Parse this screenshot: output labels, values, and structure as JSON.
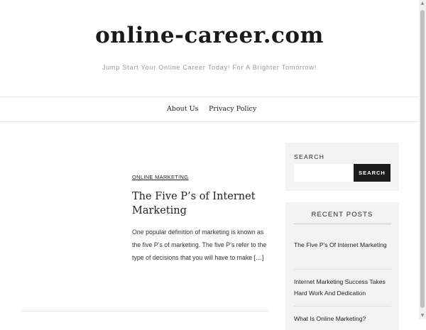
{
  "site": {
    "title": "online-career.com",
    "tagline": "Jump Start Your Online Career Today! For A Brighter Tomorrow!"
  },
  "nav": {
    "items": [
      {
        "label": "About Us"
      },
      {
        "label": "Privacy Policy"
      }
    ]
  },
  "post": {
    "category": "ONLINE MARKETING",
    "title": "The Five P’s of Internet Marketing",
    "excerpt": "One popular definition of marketing is known as the five P’s of marketing. The five P’s refer to the type of decisions that you will have to make […]"
  },
  "sidebar": {
    "search": {
      "label": "SEARCH",
      "placeholder": "",
      "value": "",
      "button_label": "SEARCH"
    },
    "recent": {
      "title": "RECENT POSTS",
      "items": [
        {
          "label": "The Five P’s Of Internet Marketing"
        },
        {
          "label": "Internet Marketing Success Takes Hard Work And Dedication"
        },
        {
          "label": "What Is Online Marketing?"
        }
      ]
    }
  },
  "scrollbar": {
    "up_icon": "arrow-up-icon",
    "down_icon": "arrow-down-icon"
  }
}
